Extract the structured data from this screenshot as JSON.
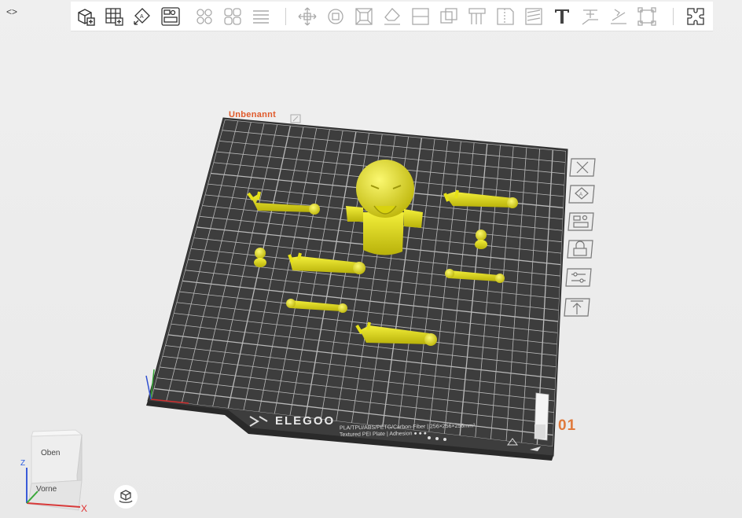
{
  "toolbar": {
    "icons": [
      "add-object-icon",
      "add-plate-icon",
      "auto-orient-icon",
      "arrange-icon",
      "split-objects-icon",
      "split-parts-icon",
      "layers-icon",
      "move-icon",
      "rotate-icon",
      "scale-icon",
      "lay-on-face-icon",
      "cut-icon",
      "mesh-boolean-icon",
      "support-painting-icon",
      "seam-painting-icon",
      "fuzzy-skin-icon",
      "text-icon",
      "emboss-icon",
      "measure-icon",
      "assembly-icon",
      "puzzle-icon"
    ]
  },
  "plate": {
    "name": "Unbenannt",
    "number": "01",
    "brand": "ELEGOO",
    "info_line1": "PLA/TPU/ABS/PETG/Carbon-Fiber | 256×256×256mm³",
    "info_line2": "Textured PEI Plate | Adhesion ● ● ●"
  },
  "side_tools": [
    "close-icon",
    "auto-orient-plate-icon",
    "arrange-plate-icon",
    "lock-icon",
    "plate-settings-icon",
    "move-to-top-icon"
  ],
  "view_cube": {
    "top_label": "Oben",
    "front_label": "Vorne",
    "x_label": "X",
    "z_label": "Z"
  },
  "colors": {
    "plate": "#4a4a4a",
    "grid": "#d8d8d8",
    "model": "#e6e117",
    "accent": "#e05a2b"
  }
}
